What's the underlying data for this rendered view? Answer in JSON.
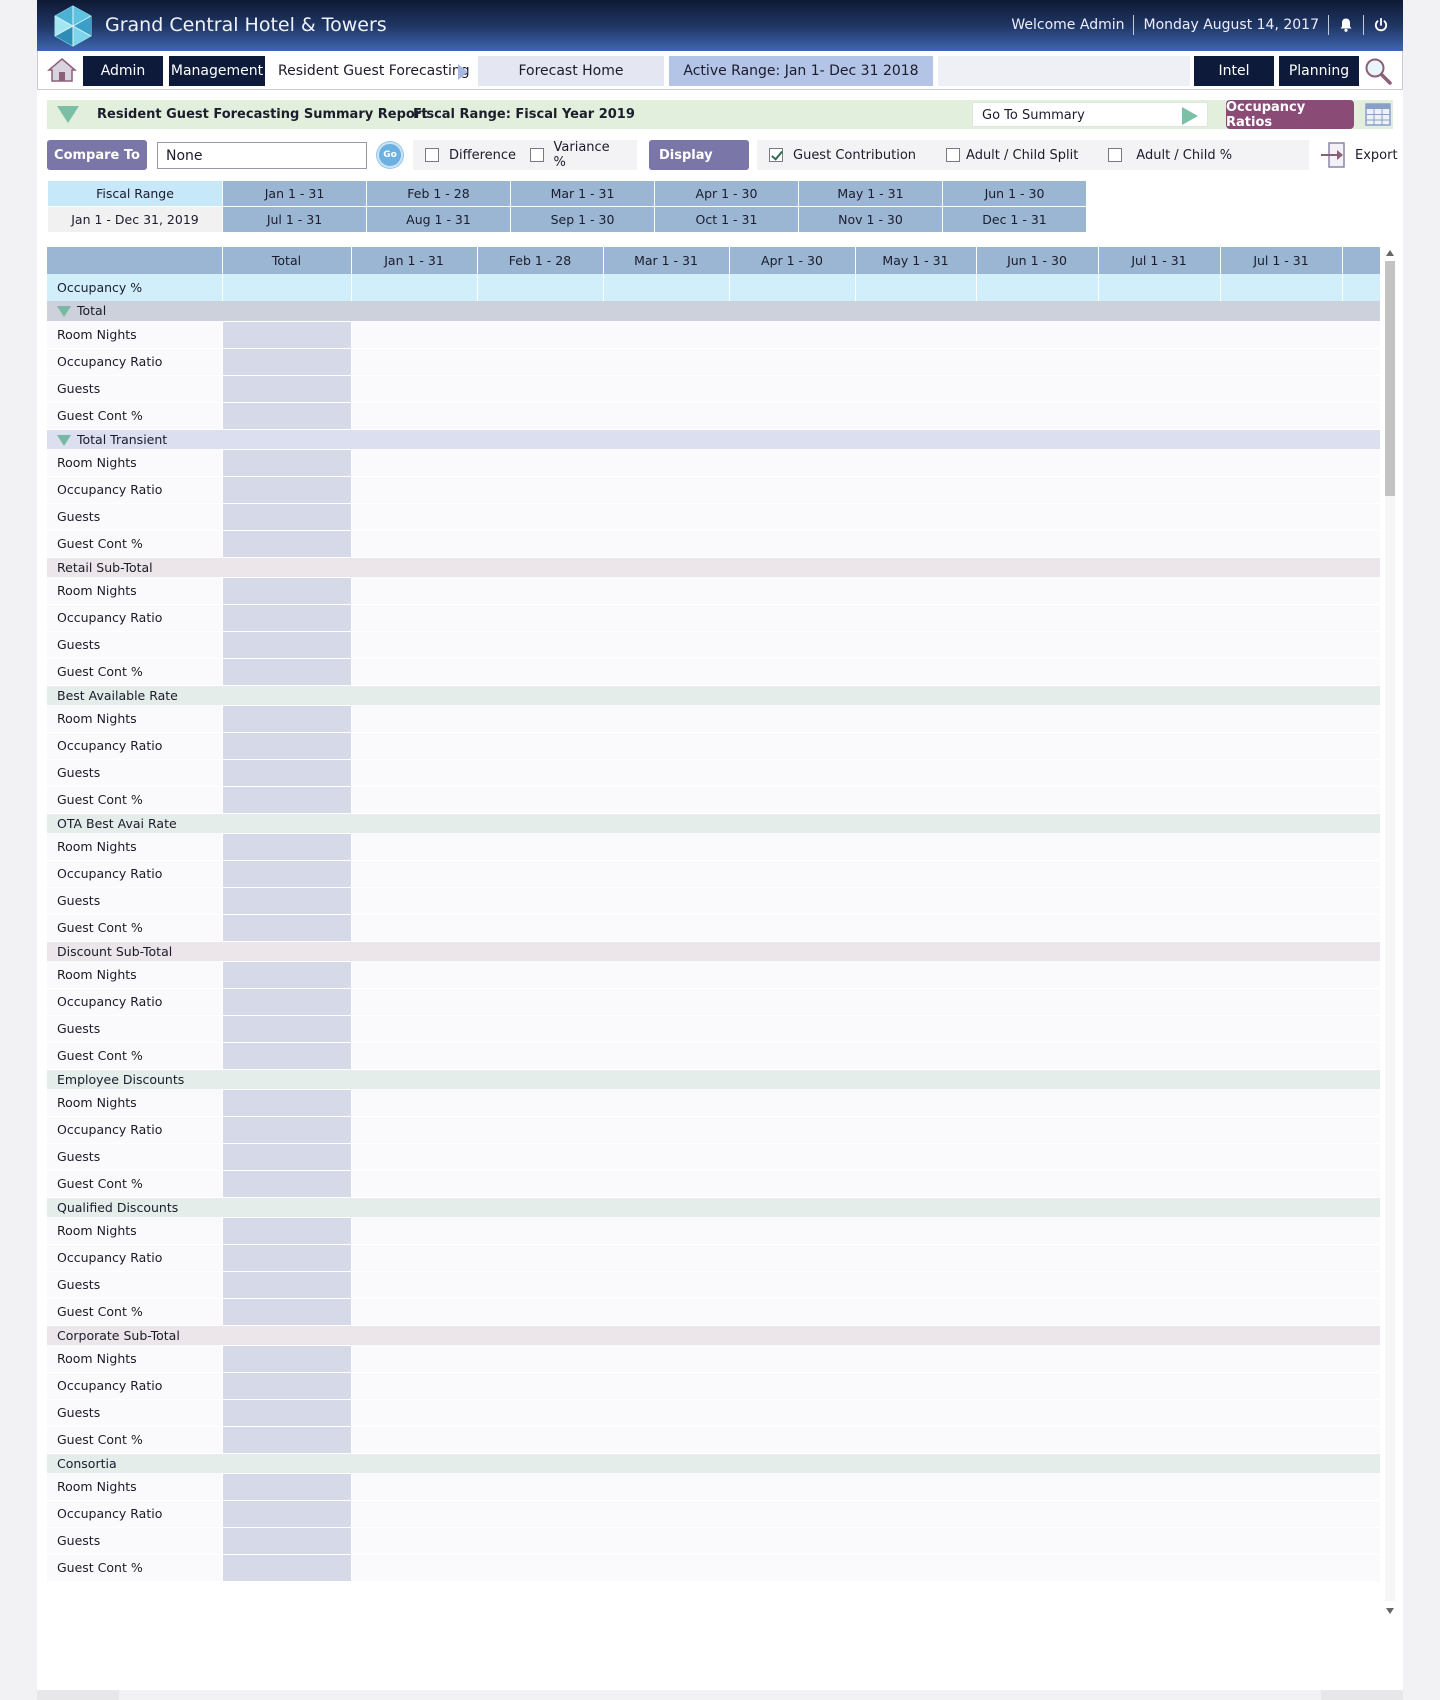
{
  "header": {
    "hotel_name": "Grand Central Hotel & Towers",
    "welcome": "Welcome Admin",
    "date": "Monday August 14, 2017"
  },
  "nav": {
    "admin": "Admin",
    "management": "Management",
    "breadcrumb": "Resident Guest Forecasting",
    "forecast_home": "Forecast Home",
    "active_range": "Active Range: Jan 1- Dec 31 2018",
    "intel": "Intel",
    "planning": "Planning"
  },
  "summary": {
    "title": "Resident Guest Forecasting Summary Report",
    "fiscal_range": "Fiscal Range: Fiscal Year 2019",
    "goto_value": "Go To Summary",
    "occupancy_ratios": "Occupancy Ratios"
  },
  "controls": {
    "compare_to": "Compare To",
    "compare_value": "None",
    "go": "Go",
    "difference": "Difference",
    "variance": "Variance %",
    "display": "Display",
    "guest_contribution": "Guest Contribution",
    "adult_child_split": "Adult / Child Split",
    "adult_child_pct": "Adult / Child %",
    "export": "Export"
  },
  "fiscal_grid": {
    "label_top": "Fiscal Range",
    "label_bottom": "Jan 1 - Dec 31, 2019",
    "row1": [
      "Jan 1 - 31",
      "Feb 1 - 28",
      "Mar 1 - 31",
      "Apr 1 - 30",
      "May 1 - 31",
      "Jun 1 - 30"
    ],
    "row2": [
      "Jul 1 - 31",
      "Aug 1 - 31",
      "Sep 1 - 30",
      "Oct 1 - 31",
      "Nov 1 - 30",
      "Dec 1 - 31"
    ]
  },
  "table": {
    "columns": [
      "",
      "Total",
      "Jan 1 - 31",
      "Feb 1 - 28",
      "Mar 1 - 31",
      "Apr 1 - 30",
      "May 1 - 31",
      "Jun 1 - 30",
      "Jul 1 - 31",
      "Jul 1 - 31",
      ""
    ],
    "occupancy_label": "Occupancy %",
    "metrics": [
      "Room Nights",
      "Occupancy Ratio",
      "Guests",
      "Guest Cont %"
    ],
    "groups": [
      {
        "label": "Total",
        "style": "g-total",
        "caret": true
      },
      {
        "label": "Total Transient",
        "style": "g-trans",
        "caret": true
      },
      {
        "label": "Retail Sub-Total",
        "style": "g-sub",
        "caret": false
      },
      {
        "label": "Best Available Rate",
        "style": "g-seg",
        "caret": false
      },
      {
        "label": "OTA Best Avai Rate",
        "style": "g-seg",
        "caret": false
      },
      {
        "label": "Discount Sub-Total",
        "style": "g-sub",
        "caret": false
      },
      {
        "label": "Employee Discounts",
        "style": "g-seg",
        "caret": false
      },
      {
        "label": "Qualified Discounts",
        "style": "g-seg",
        "caret": false
      },
      {
        "label": "Corporate Sub-Total",
        "style": "g-sub",
        "caret": false
      },
      {
        "label": "Consortia",
        "style": "g-seg",
        "caret": false
      }
    ]
  }
}
